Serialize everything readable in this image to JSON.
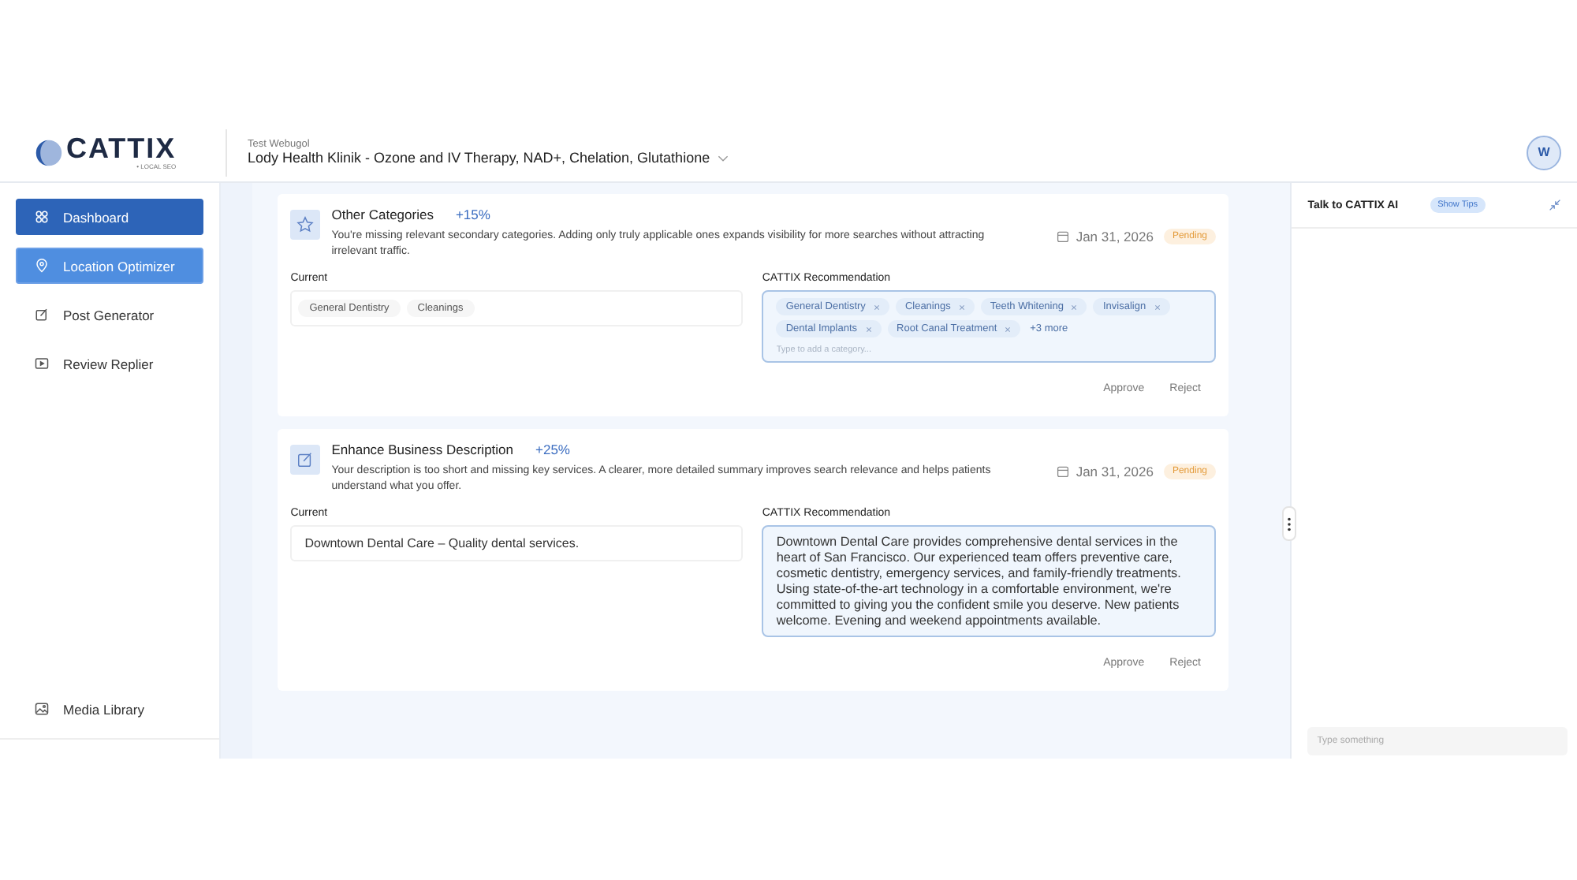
{
  "header": {
    "logo": "CATTIX",
    "logo_tagline": "• LOCAL SEO",
    "account": "Test Webugol",
    "location": "Lody Health Klinik - Ozone and IV Therapy, NAD+, Chelation, Glutathione",
    "avatar": "W"
  },
  "sidebar": {
    "items": [
      {
        "label": "Dashboard",
        "selected": true,
        "highlighted": false
      },
      {
        "label": "Location Optimizer",
        "selected": false,
        "highlighted": true
      },
      {
        "label": "Post Generator",
        "selected": false,
        "highlighted": false
      },
      {
        "label": "Review Replier",
        "selected": false,
        "highlighted": false
      }
    ],
    "footer_items": [
      {
        "label": "Media Library",
        "selected": false,
        "highlighted": false
      }
    ]
  },
  "cards": [
    {
      "kind": "categories",
      "title": "Other Categories",
      "gain": "+15%",
      "description": "You're missing relevant secondary categories. Adding only truly applicable ones expands visibility for more searches without attracting irrelevant traffic.",
      "date": "Jan 31, 2026",
      "status": "Pending",
      "current_label": "Current",
      "current_chips": [
        "General Dentistry",
        "Cleanings"
      ],
      "recommendation_label": "CATTIX Recommendation",
      "recommended_chips": [
        "General Dentistry",
        "Cleanings",
        "Teeth Whitening",
        "Invisalign",
        "Dental Implants",
        "Root Canal Treatment"
      ],
      "more": "+3 more",
      "placeholder": "Type to add a category...",
      "actions": [
        "Approve",
        "Reject"
      ]
    },
    {
      "kind": "description",
      "title": "Enhance Business Description",
      "gain": "+25%",
      "description": "Your description is too short and missing key services. A clearer, more detailed summary improves search relevance and helps patients understand what you offer.",
      "date": "Jan 31, 2026",
      "status": "Pending",
      "current_label": "Current",
      "current_text": "Downtown Dental Care – Quality dental services.",
      "recommendation_label": "CATTIX Recommendation",
      "recommended_text": "Downtown Dental Care provides comprehensive dental services in the heart of San Francisco. Our experienced team offers preventive care, cosmetic dentistry, emergency services, and family-friendly treatments. Using state-of-the-art technology in a comfortable environment, we're committed to giving you the confident smile you deserve. New patients welcome. Evening and weekend appointments available.",
      "actions": [
        "Approve",
        "Reject"
      ]
    }
  ],
  "chat": {
    "title": "Talk to CATTIX AI",
    "tips_button": "Show Tips",
    "placeholder": "Type something"
  }
}
